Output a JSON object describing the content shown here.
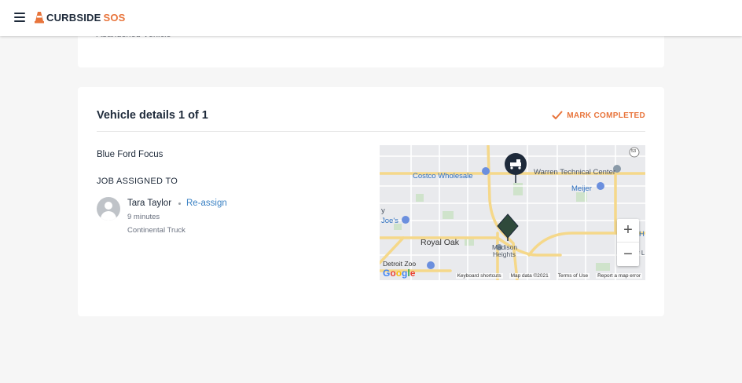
{
  "header": {
    "brand_primary": "CURBSIDE",
    "brand_secondary": "SOS"
  },
  "previous_card": {
    "text": "Abandoned Vehicle"
  },
  "vehicle_card": {
    "title": "Vehicle details 1 of 1",
    "mark_completed_label": "MARK COMPLETED",
    "vehicle_name": "Blue Ford Focus",
    "assigned_label": "JOB ASSIGNED TO",
    "assignee": {
      "name": "Tara Taylor",
      "reassign_label": "Re-assign",
      "eta": "9 minutes",
      "company": "Continental Truck"
    }
  },
  "map": {
    "labels": {
      "costco": "Costco Wholesale",
      "warren": "Warren Technical Center",
      "meijer": "Meijer",
      "joes": "Joe's",
      "royal_oak": "Royal Oak",
      "madison1": "Madison",
      "madison2": "Heights",
      "detroit_zoo": "Detroit Zoo",
      "route_sign": "53",
      "edge_y": "y",
      "edge_h": "H",
      "edge_l": "r L"
    },
    "zoom_in": "+",
    "zoom_out": "−",
    "footer": {
      "shortcuts": "Keyboard shortcuts",
      "map_data": "Map data ©2021",
      "terms": "Terms of Use",
      "report": "Report a map error"
    },
    "google_letters": [
      "G",
      "o",
      "o",
      "g",
      "l",
      "e"
    ]
  },
  "colors": {
    "accent": "#e8743b",
    "link": "#3b82c4",
    "dark": "#1e2a3a"
  }
}
